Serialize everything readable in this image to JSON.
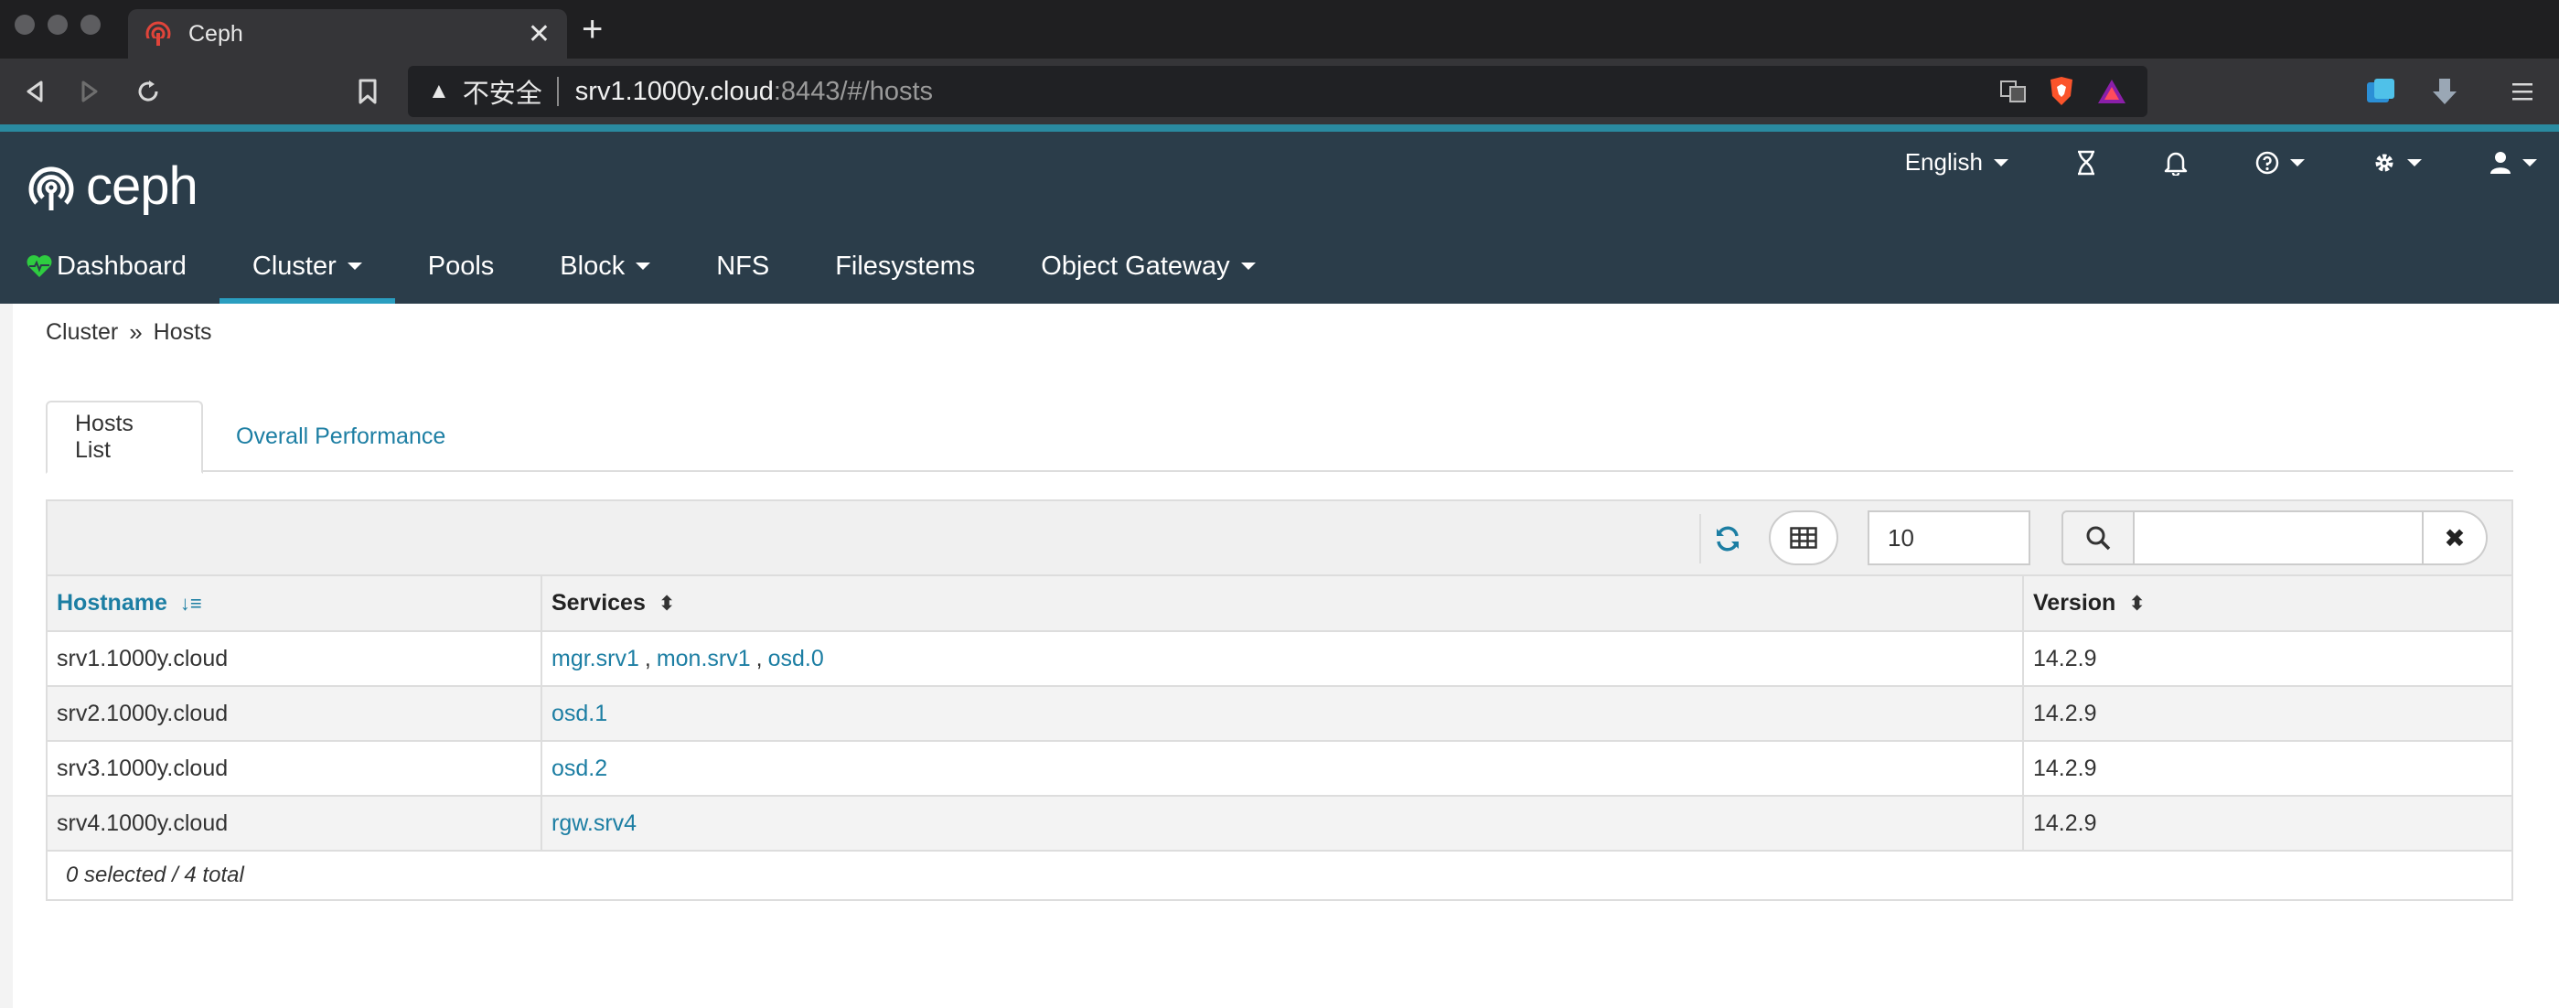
{
  "browser": {
    "tab_title": "Ceph",
    "url_warning": "不安全",
    "url_host": "srv1.1000y.cloud",
    "url_path": ":8443/#/hosts"
  },
  "header": {
    "logo_text": "ceph",
    "language": "English",
    "nav": [
      {
        "label": "Dashboard"
      },
      {
        "label": "Cluster"
      },
      {
        "label": "Pools"
      },
      {
        "label": "Block"
      },
      {
        "label": "NFS"
      },
      {
        "label": "Filesystems"
      },
      {
        "label": "Object Gateway"
      }
    ]
  },
  "breadcrumb": {
    "parent": "Cluster",
    "separator": "»",
    "current": "Hosts"
  },
  "tabs": {
    "hosts_list": "Hosts List",
    "overall_performance": "Overall Performance"
  },
  "toolbar": {
    "page_limit": "10",
    "clear_icon": "✖"
  },
  "table": {
    "columns": [
      "Hostname",
      "Services",
      "Version"
    ],
    "rows": [
      {
        "hostname": "srv1.1000y.cloud",
        "services": [
          "mgr.srv1",
          "mon.srv1",
          "osd.0"
        ],
        "version": "14.2.9"
      },
      {
        "hostname": "srv2.1000y.cloud",
        "services": [
          "osd.1"
        ],
        "version": "14.2.9"
      },
      {
        "hostname": "srv3.1000y.cloud",
        "services": [
          "osd.2"
        ],
        "version": "14.2.9"
      },
      {
        "hostname": "srv4.1000y.cloud",
        "services": [
          "rgw.srv4"
        ],
        "version": "14.2.9"
      }
    ],
    "footer": "0 selected / 4 total"
  },
  "colors": {
    "header_bg": "#2b3d4a",
    "accent": "#2a9ec0",
    "link": "#1c7ea3",
    "dashboard_heart": "#2ecc40"
  }
}
